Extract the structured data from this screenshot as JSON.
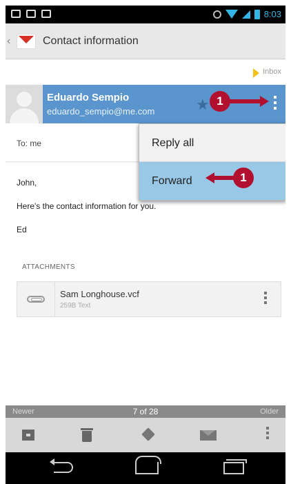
{
  "status_bar": {
    "time": "8:03",
    "icons": [
      "notification-icon",
      "voicemail-icon",
      "notification-icon",
      "sync-icon",
      "wifi-icon",
      "signal-icon",
      "battery-icon"
    ]
  },
  "action_bar": {
    "app_icon": "gmail-icon",
    "title": "Contact information"
  },
  "label": {
    "name": "Inbox",
    "color": "#f3c21a"
  },
  "sender": {
    "name": "Eduardo Sempio",
    "email": "eduardo_sempio@me.com",
    "bar_color": "#5a95cd"
  },
  "recipient": {
    "text": "To: me"
  },
  "message": {
    "lines": [
      "John,",
      "Here's the contact information for you.",
      "Ed"
    ]
  },
  "attachments": {
    "heading": "ATTACHMENTS",
    "items": [
      {
        "name": "Sam Longhouse.vcf",
        "meta": "259B Text"
      }
    ]
  },
  "popup_menu": {
    "items": [
      "Reply all",
      "Forward"
    ],
    "highlight_color": "#98c8e6"
  },
  "callouts": {
    "top": "1",
    "menu": "1",
    "color": "#b2102f"
  },
  "conversation_nav": {
    "newer": "Newer",
    "position": "7 of 28",
    "older": "Older"
  },
  "toolbar": {
    "icons": [
      "archive-icon",
      "delete-icon",
      "label-icon",
      "mark-unread-icon",
      "overflow-icon"
    ]
  }
}
